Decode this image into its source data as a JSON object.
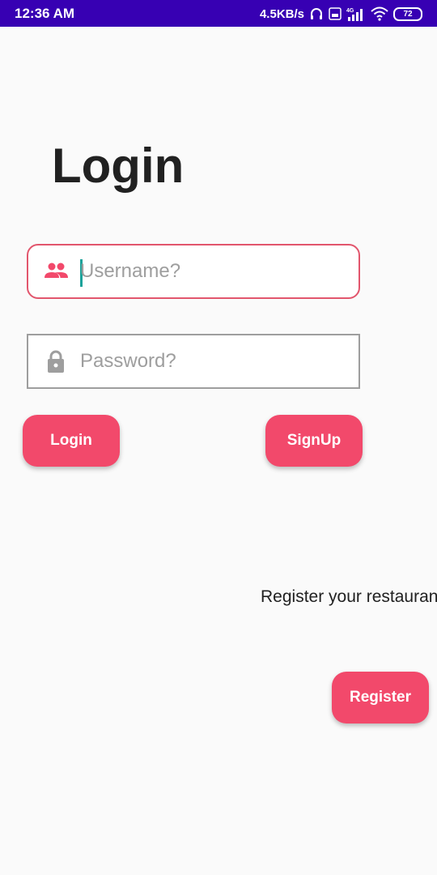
{
  "status_bar": {
    "time": "12:36 AM",
    "network_speed": "4.5KB/s",
    "network_type": "4G",
    "battery": "72",
    "icons": [
      "headphones-icon",
      "volte-icon",
      "signal-icon",
      "wifi-icon",
      "battery-icon"
    ]
  },
  "page": {
    "title": "Login"
  },
  "form": {
    "username": {
      "placeholder": "Username?",
      "value": "",
      "icon": "people-icon"
    },
    "password": {
      "placeholder": "Password?",
      "value": "",
      "icon": "lock-icon"
    }
  },
  "buttons": {
    "login": "Login",
    "signup": "SignUp",
    "register": "Register"
  },
  "register_prompt": "Register your restaurant",
  "colors": {
    "status_bar": "#3700b3",
    "accent": "#f2496b",
    "username_border": "#e2566d",
    "caret": "#1ba29a",
    "background": "#fafafa"
  }
}
